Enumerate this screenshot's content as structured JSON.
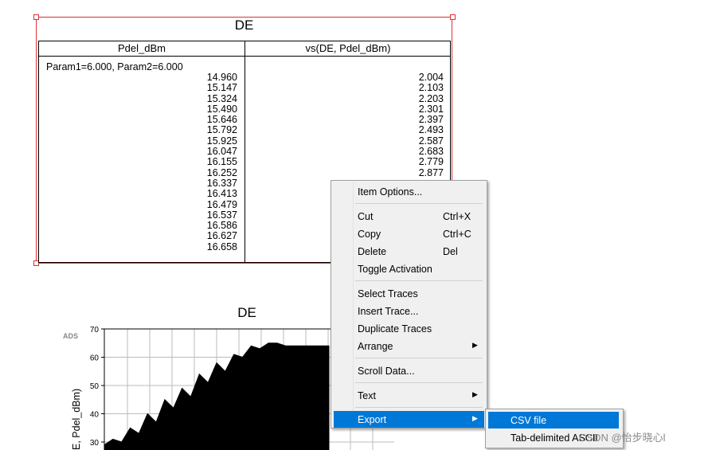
{
  "table_panel": {
    "title": "DE",
    "col1_header": "Pdel_dBm",
    "col2_header": "vs(DE, Pdel_dBm)",
    "param_label": "Param1=6.000, Param2=6.000",
    "col1_values": [
      "14.960",
      "15.147",
      "15.324",
      "15.490",
      "15.646",
      "15.792",
      "15.925",
      "16.047",
      "16.155",
      "16.252",
      "16.337",
      "16.413",
      "16.479",
      "16.537",
      "16.586",
      "16.627",
      "16.658"
    ],
    "col2_values": [
      "2.004",
      "2.103",
      "2.203",
      "2.301",
      "2.397",
      "2.493",
      "2.587",
      "2.683",
      "2.779",
      "2.877"
    ]
  },
  "chart": {
    "title": "DE",
    "logo": "ADS",
    "ylabel": "E, Pdel_dBm)",
    "yticks": [
      "70",
      "60",
      "50",
      "40",
      "30"
    ]
  },
  "chart_data": {
    "type": "area",
    "title": "DE",
    "xlabel": "",
    "ylabel": "E, Pdel_dBm)",
    "ylim": [
      25,
      70
    ],
    "x": [
      0,
      1,
      2,
      3,
      4,
      5,
      6,
      7,
      8,
      9,
      10,
      11,
      12,
      13,
      14,
      15,
      16,
      17,
      18,
      19,
      20,
      21,
      22,
      23,
      24,
      25,
      26
    ],
    "series": [
      {
        "values": [
          29,
          31,
          30,
          35,
          33,
          40,
          37,
          45,
          42,
          49,
          46,
          54,
          51,
          58,
          55,
          61,
          60,
          64,
          63,
          65,
          65,
          64,
          64,
          64,
          64,
          64,
          64
        ]
      }
    ],
    "grid": true
  },
  "context_menu": {
    "items": [
      {
        "label": "Item Options...",
        "shortcut": ""
      },
      {
        "label": "Cut",
        "shortcut": "Ctrl+X"
      },
      {
        "label": "Copy",
        "shortcut": "Ctrl+C"
      },
      {
        "label": "Delete",
        "shortcut": "Del"
      },
      {
        "label": "Toggle Activation",
        "shortcut": ""
      },
      {
        "label": "Select Traces",
        "shortcut": ""
      },
      {
        "label": "Insert Trace...",
        "shortcut": ""
      },
      {
        "label": "Duplicate Traces",
        "shortcut": ""
      },
      {
        "label": "Arrange",
        "shortcut": ""
      },
      {
        "label": "Scroll Data...",
        "shortcut": ""
      },
      {
        "label": "Text",
        "shortcut": ""
      },
      {
        "label": "Export",
        "shortcut": ""
      }
    ],
    "submenu_arrow": "▶"
  },
  "export_submenu": {
    "items": [
      "CSV file",
      "Tab-delimited ASCII"
    ]
  },
  "watermark": "CSDN @怡步晓心l",
  "colors": {
    "selection": "#e03030",
    "highlight": "#0078d7",
    "menu_bg": "#f0f0f0"
  }
}
